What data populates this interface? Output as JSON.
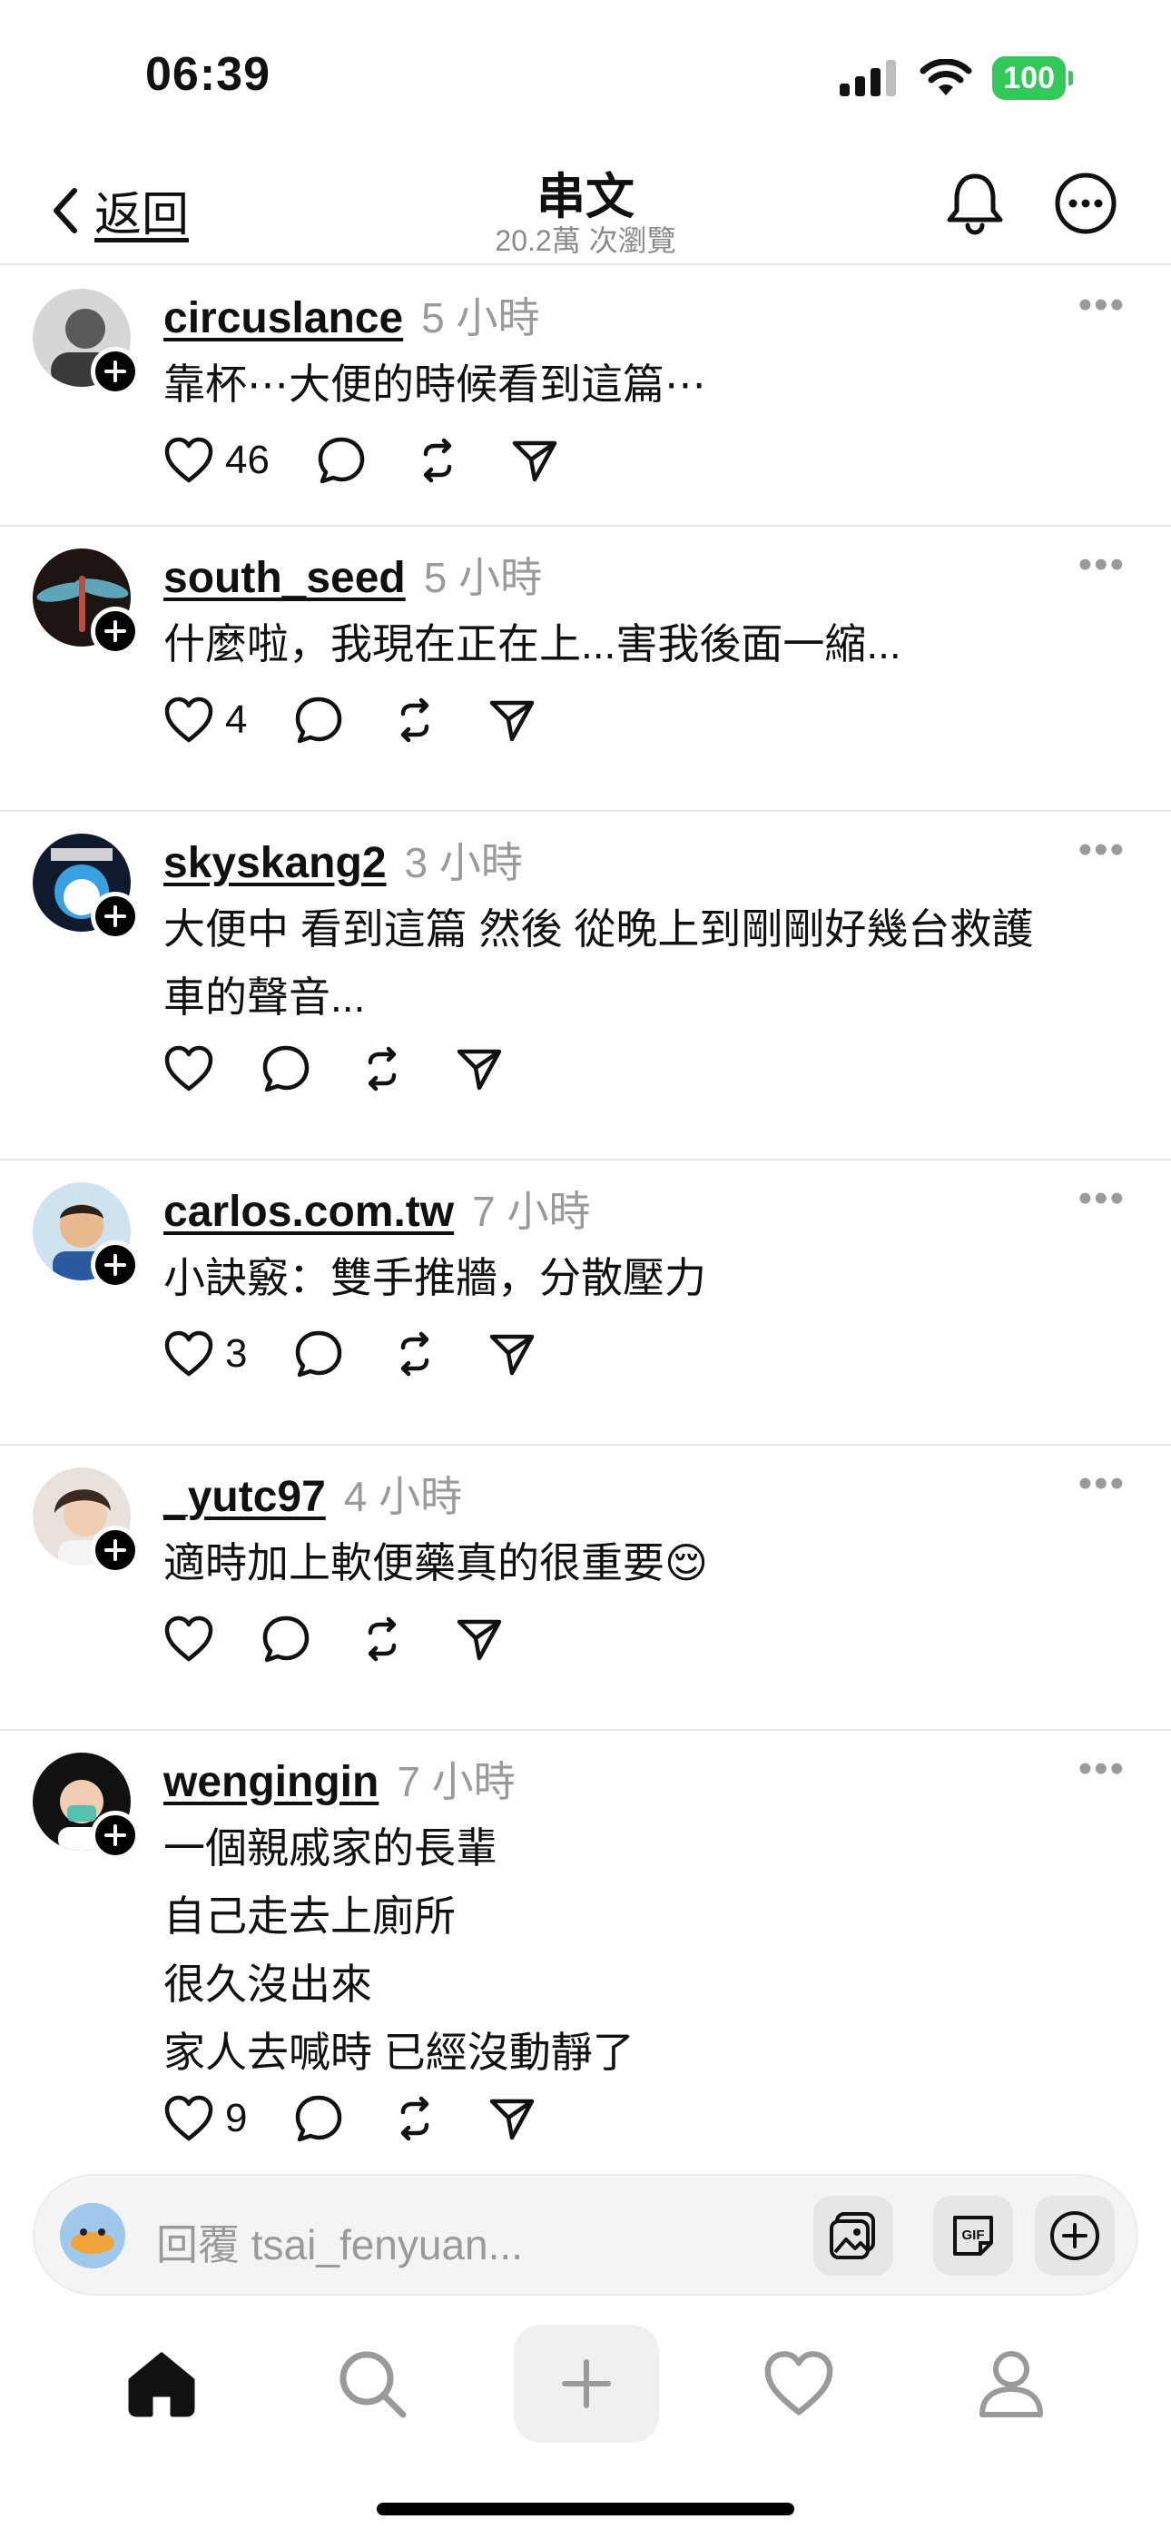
{
  "status_bar": {
    "time": "06:39",
    "battery": "100"
  },
  "header": {
    "back_label": "返回",
    "title": "串文",
    "subtitle": "20.2萬 次瀏覽"
  },
  "posts": [
    {
      "username": "circuslance",
      "time": "5 小時",
      "text": "靠杯⋯大便的時候看到這篇⋯",
      "likes": "46"
    },
    {
      "username": "south_seed",
      "time": "5 小時",
      "text": "什麼啦，我現在正在上...害我後面一縮...",
      "likes": "4"
    },
    {
      "username": "skyskang2",
      "time": "3 小時",
      "text": "大便中 看到這篇 然後 從晚上到剛剛好幾台救護\n車的聲音...",
      "likes": ""
    },
    {
      "username": "carlos.com.tw",
      "time": "7 小時",
      "text": "小訣竅：雙手推牆，分散壓力",
      "likes": "3"
    },
    {
      "username": "_yutc97",
      "time": "4 小時",
      "text": "適時加上軟便藥真的很重要😌",
      "likes": ""
    },
    {
      "username": "wengingin",
      "time": "7 小時",
      "text": "一個親戚家的長輩\n自己走去上廁所\n很久沒出來\n家人去喊時 已經沒動靜了",
      "likes": "9"
    }
  ],
  "reply": {
    "placeholder": "回覆 tsai_fenyuan..."
  },
  "post_more_glyph": "•••",
  "colors": {
    "accent_battery": "#34c759",
    "muted": "#9a9a9a",
    "divider": "#e6e6e6"
  }
}
